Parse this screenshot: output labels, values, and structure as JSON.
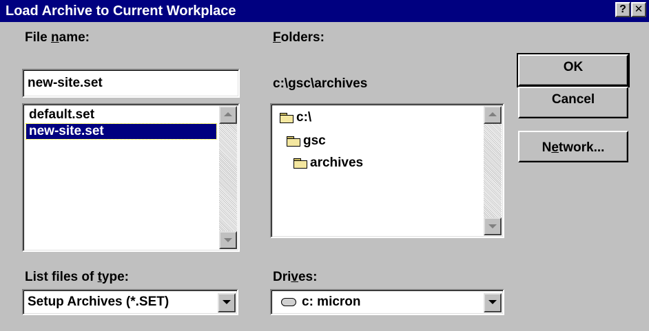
{
  "window": {
    "title": "Load Archive to Current Workplace",
    "help_glyph": "?",
    "close_glyph": "✕"
  },
  "file_name": {
    "label_pre": "File ",
    "label_ul": "n",
    "label_post": "ame:",
    "value": "new-site.set",
    "files": [
      {
        "name": "default.set",
        "selected": false
      },
      {
        "name": "new-site.set",
        "selected": true
      }
    ]
  },
  "folders": {
    "label_ul": "F",
    "label_post": "olders:",
    "current_path": "c:\\gsc\\archives",
    "tree": [
      {
        "name": "c:\\",
        "level": 0
      },
      {
        "name": "gsc",
        "level": 1
      },
      {
        "name": "archives",
        "level": 2
      }
    ]
  },
  "file_type": {
    "label_pre": "List files of ",
    "label_ul": "t",
    "label_post": "ype:",
    "selected": "Setup Archives (*.SET)"
  },
  "drives": {
    "label_pre": "Dri",
    "label_ul": "v",
    "label_post": "es:",
    "selected": "c: micron"
  },
  "buttons": {
    "ok": "OK",
    "cancel": "Cancel",
    "network_pre": "N",
    "network_ul": "e",
    "network_post": "twork..."
  },
  "icons": {
    "folder": "folder-open-icon",
    "drive": "hard-drive-icon"
  }
}
